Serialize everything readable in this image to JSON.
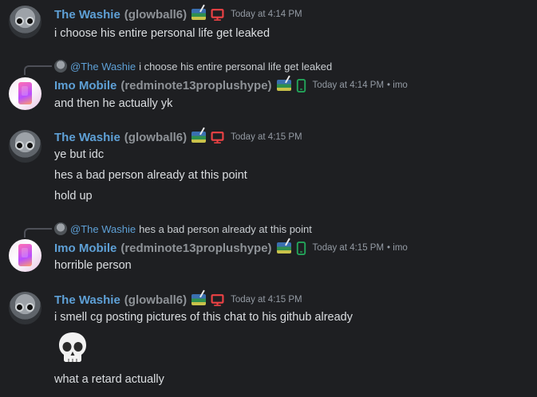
{
  "users": {
    "washie": {
      "name": "The Washie",
      "username": "(glowball6)",
      "color": "#5ea0d6"
    },
    "imo": {
      "name": "Imo Mobile",
      "username": "(redminote13proplushype)",
      "color": "#5ea0d6"
    }
  },
  "colors": {
    "desktop_icon": "#ed4245",
    "mobile_icon": "#23a55a",
    "background": "#1e1f22"
  },
  "groups": [
    {
      "timestamp": "Today at 4:14 PM",
      "messages": [
        "i choose his entire personal life get leaked"
      ]
    },
    {
      "reply": {
        "mention": "@The Washie",
        "text": "i choose his entire personal life get leaked"
      },
      "timestamp": "Today at 4:14 PM",
      "via": "• imo",
      "messages": [
        "and then he actually yk"
      ]
    },
    {
      "timestamp": "Today at 4:15 PM",
      "messages": [
        "ye but idc",
        "hes a bad person already at this point",
        "hold up"
      ]
    },
    {
      "reply": {
        "mention": "@The Washie",
        "text": "hes a bad person already at this point"
      },
      "timestamp": "Today at 4:15 PM",
      "via": "• imo",
      "messages": [
        "horrible person"
      ]
    },
    {
      "timestamp": "Today at 4:15 PM",
      "messages": [
        "i smell cg posting pictures of this chat to his github already",
        "💀",
        "what a retard actually"
      ]
    }
  ]
}
